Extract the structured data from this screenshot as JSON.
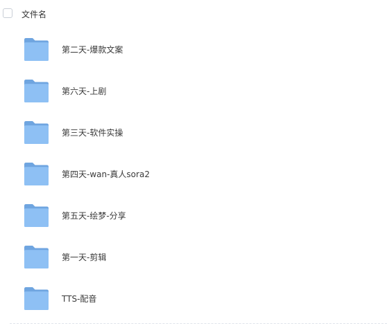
{
  "header": {
    "column_label": "文件名"
  },
  "icons": {
    "folder": "folder-icon",
    "folder_color_back": "#6fa5e0",
    "folder_color_front": "#8ec0f4"
  },
  "files": [
    {
      "name": "第二天-爆款文案",
      "type": "folder"
    },
    {
      "name": "第六天-上剧",
      "type": "folder"
    },
    {
      "name": "第三天-软件实操",
      "type": "folder"
    },
    {
      "name": "第四天-wan-真人sora2",
      "type": "folder"
    },
    {
      "name": "第五天-绘梦-分享",
      "type": "folder"
    },
    {
      "name": "第一天-剪辑",
      "type": "folder"
    },
    {
      "name": "TTS-配音",
      "type": "folder"
    }
  ]
}
